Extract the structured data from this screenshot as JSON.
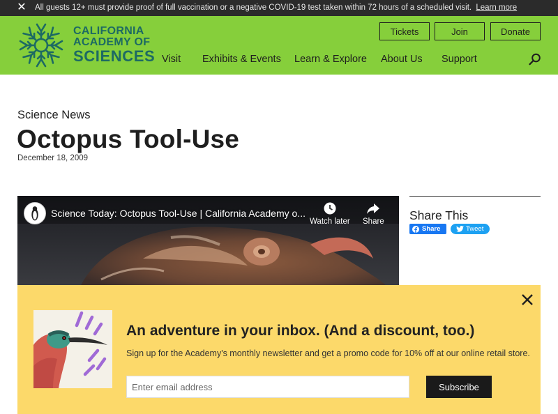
{
  "alert": {
    "message": "All guests 12+ must provide proof of full vaccination or a negative COVID-19 test taken within 72 hours of a scheduled visit.",
    "link": "Learn more",
    "close_glyph": "✕"
  },
  "brand": {
    "line1": "CALIFORNIA",
    "line2": "ACADEMY OF",
    "line3": "SCIENCES",
    "color": "#1d6a63",
    "header_bg": "#86cf3b"
  },
  "header_buttons": {
    "tickets": "Tickets",
    "join": "Join",
    "donate": "Donate"
  },
  "nav": {
    "visit": "Visit",
    "exhibits": "Exhibits & Events",
    "learn": "Learn & Explore",
    "about": "About Us",
    "support": "Support"
  },
  "article": {
    "eyebrow": "Science News",
    "title": "Octopus Tool-Use",
    "date": "December 18, 2009"
  },
  "video": {
    "title": "Science Today: Octopus Tool-Use | California Academy o...",
    "watch_later": "Watch later",
    "share": "Share"
  },
  "share": {
    "heading": "Share This",
    "facebook": "Share",
    "twitter": "Tweet",
    "facebook_color": "#1877f2",
    "twitter_color": "#1da1f2"
  },
  "promo": {
    "title": "An adventure in your inbox. (And a discount, too.)",
    "subtitle": "Sign up for the Academy's monthly newsletter and get a promo code for 10% off at our online retail store.",
    "email_placeholder": "Enter email address",
    "submit": "Subscribe",
    "bg": "#fcd96a"
  }
}
